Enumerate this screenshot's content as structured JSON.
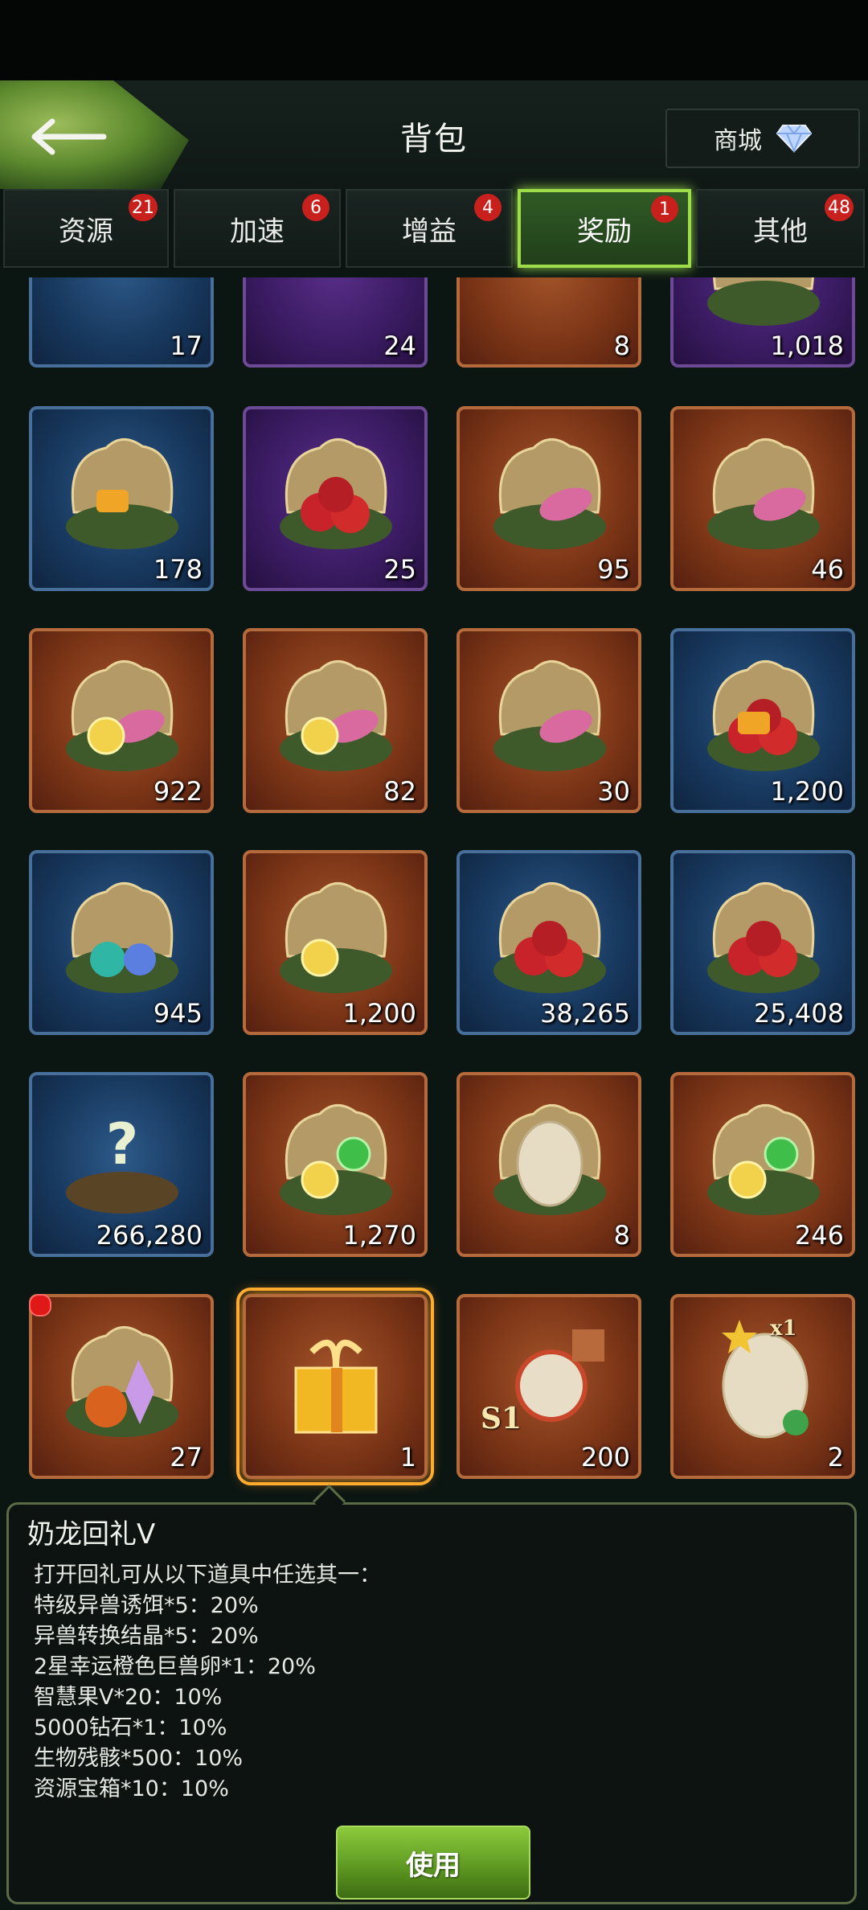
{
  "header": {
    "title": "背包",
    "store_label": "商城"
  },
  "tabs": [
    {
      "label": "资源",
      "badge": "21",
      "active": false
    },
    {
      "label": "加速",
      "badge": "6",
      "active": false
    },
    {
      "label": "增益",
      "badge": "4",
      "active": false
    },
    {
      "label": "奖励",
      "badge": "1",
      "active": true
    },
    {
      "label": "其他",
      "badge": "48",
      "active": false
    }
  ],
  "items": [
    {
      "count": "17",
      "rarity": "blue",
      "icon": "spiky-fruit-icon"
    },
    {
      "count": "24",
      "rarity": "purple",
      "icon": "flower-icon"
    },
    {
      "count": "8",
      "rarity": "orange",
      "icon": "orange-spiky-fruit-icon"
    },
    {
      "count": "1,018",
      "rarity": "purple",
      "icon": "nest-chest-icon"
    },
    {
      "count": "178",
      "rarity": "blue",
      "icon": "shell-chest-honey-icon"
    },
    {
      "count": "25",
      "rarity": "purple",
      "icon": "shell-chest-apples-icon"
    },
    {
      "count": "95",
      "rarity": "orange",
      "icon": "shell-chest-petals-icon"
    },
    {
      "count": "46",
      "rarity": "orange",
      "icon": "shell-chest-tendrils-icon"
    },
    {
      "count": "922",
      "rarity": "orange",
      "icon": "shell-chest-dna-icon"
    },
    {
      "count": "82",
      "rarity": "orange",
      "icon": "shell-chest-gold-icon"
    },
    {
      "count": "30",
      "rarity": "orange",
      "icon": "shell-chest-coral-icon"
    },
    {
      "count": "1,200",
      "rarity": "blue",
      "icon": "shell-chest-apples-honey-icon"
    },
    {
      "count": "945",
      "rarity": "blue",
      "icon": "shell-chest-bones-icon"
    },
    {
      "count": "1,200",
      "rarity": "orange",
      "icon": "shell-chest-yellow-orb-icon"
    },
    {
      "count": "38,265",
      "rarity": "blue",
      "icon": "shell-chest-apples-icon"
    },
    {
      "count": "25,408",
      "rarity": "blue",
      "icon": "shell-chest-apples-icon"
    },
    {
      "count": "266,280",
      "rarity": "blue",
      "icon": "mystery-nest-icon"
    },
    {
      "count": "1,270",
      "rarity": "orange",
      "icon": "shell-chest-green-orb-icon"
    },
    {
      "count": "8",
      "rarity": "orange",
      "icon": "shell-chest-egg-icon"
    },
    {
      "count": "246",
      "rarity": "orange",
      "icon": "shell-chest-green-orb-icon"
    },
    {
      "count": "27",
      "rarity": "orange",
      "icon": "shell-chest-crystal-icon",
      "new": true
    },
    {
      "count": "1",
      "rarity": "orange",
      "icon": "gift-box-icon",
      "selected": true
    },
    {
      "count": "200",
      "rarity": "orange",
      "icon": "lion-emblem-puzzle-icon",
      "tag": "S1"
    },
    {
      "count": "2",
      "rarity": "orange",
      "icon": "lucky-egg-icon",
      "tag": "x1"
    }
  ],
  "detail": {
    "name": "奶龙回礼V",
    "intro": "打开回礼可从以下道具中任选其一：",
    "lines": [
      "特级异兽诱饵*5：20%",
      "异兽转换结晶*5：20%",
      "2星幸运橙色巨兽卵*1：20%",
      "智慧果V*20：10%",
      "5000钻石*1：10%",
      "生物残骸*500：10%",
      "资源宝箱*10：10%"
    ],
    "use_label": "使用"
  },
  "colors": {
    "accent_green": "#9fdc4a",
    "badge_red": "#c8201c",
    "selected_orange": "#ffab2e"
  }
}
